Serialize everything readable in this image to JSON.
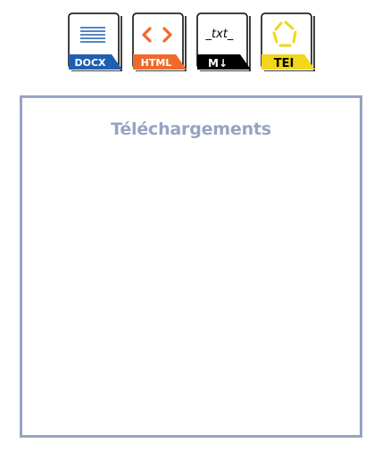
{
  "formats": [
    {
      "id": "docx",
      "label": "DOCX",
      "icon": "docx-file-icon",
      "color": "#1f5fb2"
    },
    {
      "id": "html",
      "label": "HTML",
      "icon": "html-file-icon",
      "color": "#ef6a2a",
      "glyph": "< >"
    },
    {
      "id": "md",
      "label": "M↓",
      "icon": "markdown-file-icon",
      "color": "#000000",
      "glyph": "_txt_"
    },
    {
      "id": "tei",
      "label": "TEI",
      "icon": "tei-file-icon",
      "color": "#f2d619"
    }
  ],
  "panel": {
    "title": "Téléchargements",
    "border_color": "#97a3c2"
  }
}
